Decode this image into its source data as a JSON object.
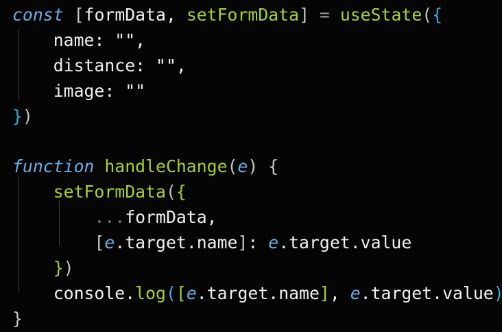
{
  "colors": {
    "background": "#050505",
    "keyword": "#6ab0e6",
    "function": "#a6d22e",
    "text": "#f0f0f0",
    "bracket_alt": "#3fa9de",
    "spread": "#777777"
  },
  "code": {
    "lines": [
      [
        {
          "t": "const",
          "c": "k"
        },
        {
          "t": " ",
          "c": "p"
        },
        {
          "t": "[",
          "c": "b"
        },
        {
          "t": "formData",
          "c": "v"
        },
        {
          "t": ", ",
          "c": "p"
        },
        {
          "t": "setFormData",
          "c": "f"
        },
        {
          "t": "]",
          "c": "b"
        },
        {
          "t": " ",
          "c": "p"
        },
        {
          "t": "=",
          "c": "op"
        },
        {
          "t": " ",
          "c": "p"
        },
        {
          "t": "useState",
          "c": "f"
        },
        {
          "t": "(",
          "c": "b"
        },
        {
          "t": "{",
          "c": "bb"
        }
      ],
      [
        {
          "t": "    ",
          "c": "p"
        },
        {
          "t": "name",
          "c": "pr"
        },
        {
          "t": ": ",
          "c": "p"
        },
        {
          "t": "\"\"",
          "c": "s"
        },
        {
          "t": ",",
          "c": "p"
        }
      ],
      [
        {
          "t": "    ",
          "c": "p"
        },
        {
          "t": "distance",
          "c": "pr"
        },
        {
          "t": ": ",
          "c": "p"
        },
        {
          "t": "\"\"",
          "c": "s"
        },
        {
          "t": ",",
          "c": "p"
        }
      ],
      [
        {
          "t": "    ",
          "c": "p"
        },
        {
          "t": "image",
          "c": "pr"
        },
        {
          "t": ": ",
          "c": "p"
        },
        {
          "t": "\"\"",
          "c": "s"
        }
      ],
      [
        {
          "t": "}",
          "c": "bb"
        },
        {
          "t": ")",
          "c": "b"
        }
      ],
      [],
      [
        {
          "t": "function",
          "c": "k"
        },
        {
          "t": " ",
          "c": "p"
        },
        {
          "t": "handleChange",
          "c": "f"
        },
        {
          "t": "(",
          "c": "b"
        },
        {
          "t": "e",
          "c": "k"
        },
        {
          "t": ")",
          "c": "b"
        },
        {
          "t": " ",
          "c": "p"
        },
        {
          "t": "{",
          "c": "b"
        }
      ],
      [
        {
          "t": "    ",
          "c": "p"
        },
        {
          "t": "setFormData",
          "c": "f"
        },
        {
          "t": "(",
          "c": "b"
        },
        {
          "t": "{",
          "c": "f"
        }
      ],
      [
        {
          "t": "        ",
          "c": "p"
        },
        {
          "t": "...",
          "c": "sp"
        },
        {
          "t": "formData",
          "c": "v"
        },
        {
          "t": ",",
          "c": "p"
        }
      ],
      [
        {
          "t": "        ",
          "c": "p"
        },
        {
          "t": "[",
          "c": "b"
        },
        {
          "t": "e",
          "c": "k"
        },
        {
          "t": ".target.name",
          "c": "v"
        },
        {
          "t": "]",
          "c": "b"
        },
        {
          "t": ": ",
          "c": "p"
        },
        {
          "t": "e",
          "c": "k"
        },
        {
          "t": ".target.value",
          "c": "v"
        }
      ],
      [
        {
          "t": "    ",
          "c": "p"
        },
        {
          "t": "}",
          "c": "f"
        },
        {
          "t": ")",
          "c": "b"
        }
      ],
      [
        {
          "t": "    ",
          "c": "p"
        },
        {
          "t": "console.",
          "c": "v"
        },
        {
          "t": "log",
          "c": "f"
        },
        {
          "t": "(",
          "c": "bb"
        },
        {
          "t": "[",
          "c": "f"
        },
        {
          "t": "e",
          "c": "k"
        },
        {
          "t": ".target.name",
          "c": "v"
        },
        {
          "t": "]",
          "c": "f"
        },
        {
          "t": ", ",
          "c": "p"
        },
        {
          "t": "e",
          "c": "k"
        },
        {
          "t": ".target.value",
          "c": "v"
        },
        {
          "t": ")",
          "c": "bb"
        }
      ],
      [
        {
          "t": "}",
          "c": "b"
        }
      ]
    ]
  }
}
